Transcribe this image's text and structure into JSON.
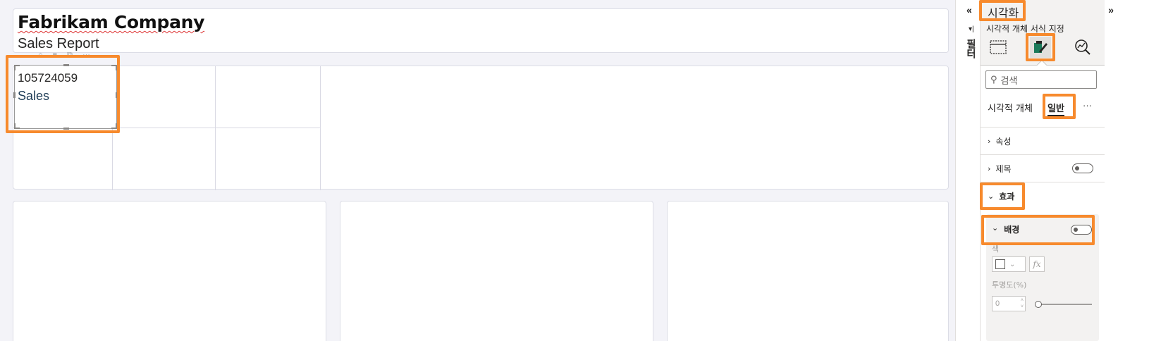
{
  "report": {
    "title": "Fabrikam Company",
    "subtitle": "Sales Report"
  },
  "kpi_card": {
    "value": "105724059",
    "label": "Sales"
  },
  "filters_rail": {
    "collapse_glyph": "«",
    "label": "필터"
  },
  "viz_pane": {
    "title": "시각화",
    "expand_glyph": "»",
    "subtitle": "시각적 개체 서식 지정",
    "tabs": [
      {
        "icon": "build-visual-icon"
      },
      {
        "icon": "format-visual-icon"
      },
      {
        "icon": "analytics-icon"
      }
    ],
    "search_placeholder": "검색",
    "subtabs": {
      "visual": "시각적 개체",
      "general": "일반",
      "more": "···"
    },
    "sections": {
      "properties": "속성",
      "title": "제목",
      "effects": "효과"
    },
    "background": {
      "label": "배경",
      "color_label": "색",
      "fx_label": "fx",
      "transparency_label": "투명도(%)",
      "transparency_value": "0"
    }
  },
  "colors": {
    "highlight": "#f78a2d",
    "canvas_bg": "#f3f3f8",
    "pane_bg": "#f3f2f1"
  }
}
